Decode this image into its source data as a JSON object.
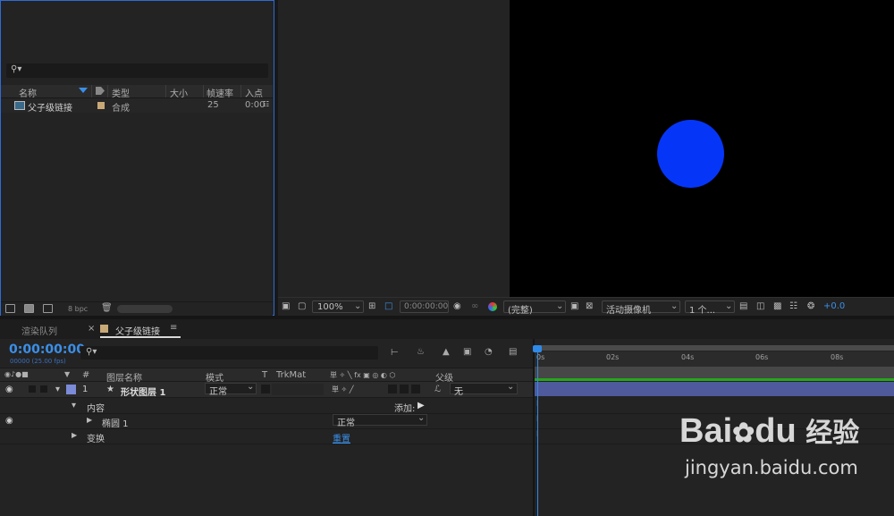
{
  "project": {
    "search_icon": "magnifier-icon",
    "columns": {
      "name": "名称",
      "type": "类型",
      "size": "大小",
      "fps": "帧速率",
      "in": "入点"
    },
    "items": [
      {
        "name": "父子级链接",
        "type": "合成",
        "fps": "25",
        "in": "0:00"
      }
    ],
    "bpc": "8 bpc"
  },
  "viewer": {
    "zoom": "100%",
    "timecode": "0:00:00:00",
    "resolution": "(完整)",
    "camera": "活动摄像机",
    "views": "1 个...",
    "exposure": "+0.0",
    "circle_color": "#0536f8"
  },
  "tabs": {
    "render_queue": "渲染队列",
    "comp": "父子级链接",
    "close": "×",
    "menu": "≡"
  },
  "timeline": {
    "timecode": "0:00:00:00",
    "frame_info": "00000 (25.00 fps)",
    "columns": {
      "num": "#",
      "layer_name": "图层名称",
      "mode": "模式",
      "t": "T",
      "trkmat": "TrkMat",
      "parent": "父级"
    },
    "switch_icons": "単 ✧ ╲ fx ▣ ◎ ◐ ⬡",
    "layer": {
      "index": "1",
      "name": "形状图层 1",
      "mode": "正常",
      "parent": "无",
      "switches": "単 ✧ ╱",
      "label_color": "#7b8bd8"
    },
    "contents": {
      "label": "内容",
      "add_label": "添加:"
    },
    "ellipse": {
      "label": "椭圆 1",
      "mode": "正常"
    },
    "transform": {
      "label": "变换",
      "reset": "重置"
    },
    "ruler_ticks": [
      "0s",
      "02s",
      "04s",
      "06s",
      "08s"
    ],
    "timecode_color": "#3b8fe8"
  },
  "watermark": {
    "brand": "Bai",
    "brand2": "du",
    "product": "经验",
    "url": "jingyan.baidu.com"
  }
}
